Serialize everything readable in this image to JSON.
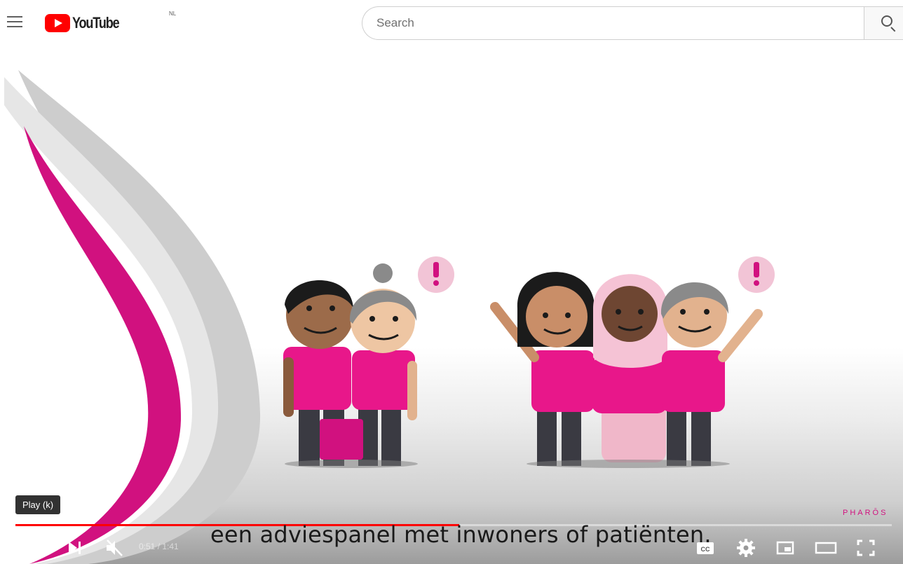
{
  "header": {
    "logo_text": "YouTube",
    "logo_superscript": "NL",
    "search_placeholder": "Search"
  },
  "player": {
    "caption": "een adviespanel met inwoners of patiënten.",
    "tooltip": "Play (k)",
    "brand_watermark": "PHARŌS",
    "time_display": "0:51 / 1:41",
    "progress_fraction": 0.506,
    "accent_color": "#d1117f",
    "progress_color": "#ff0000"
  }
}
